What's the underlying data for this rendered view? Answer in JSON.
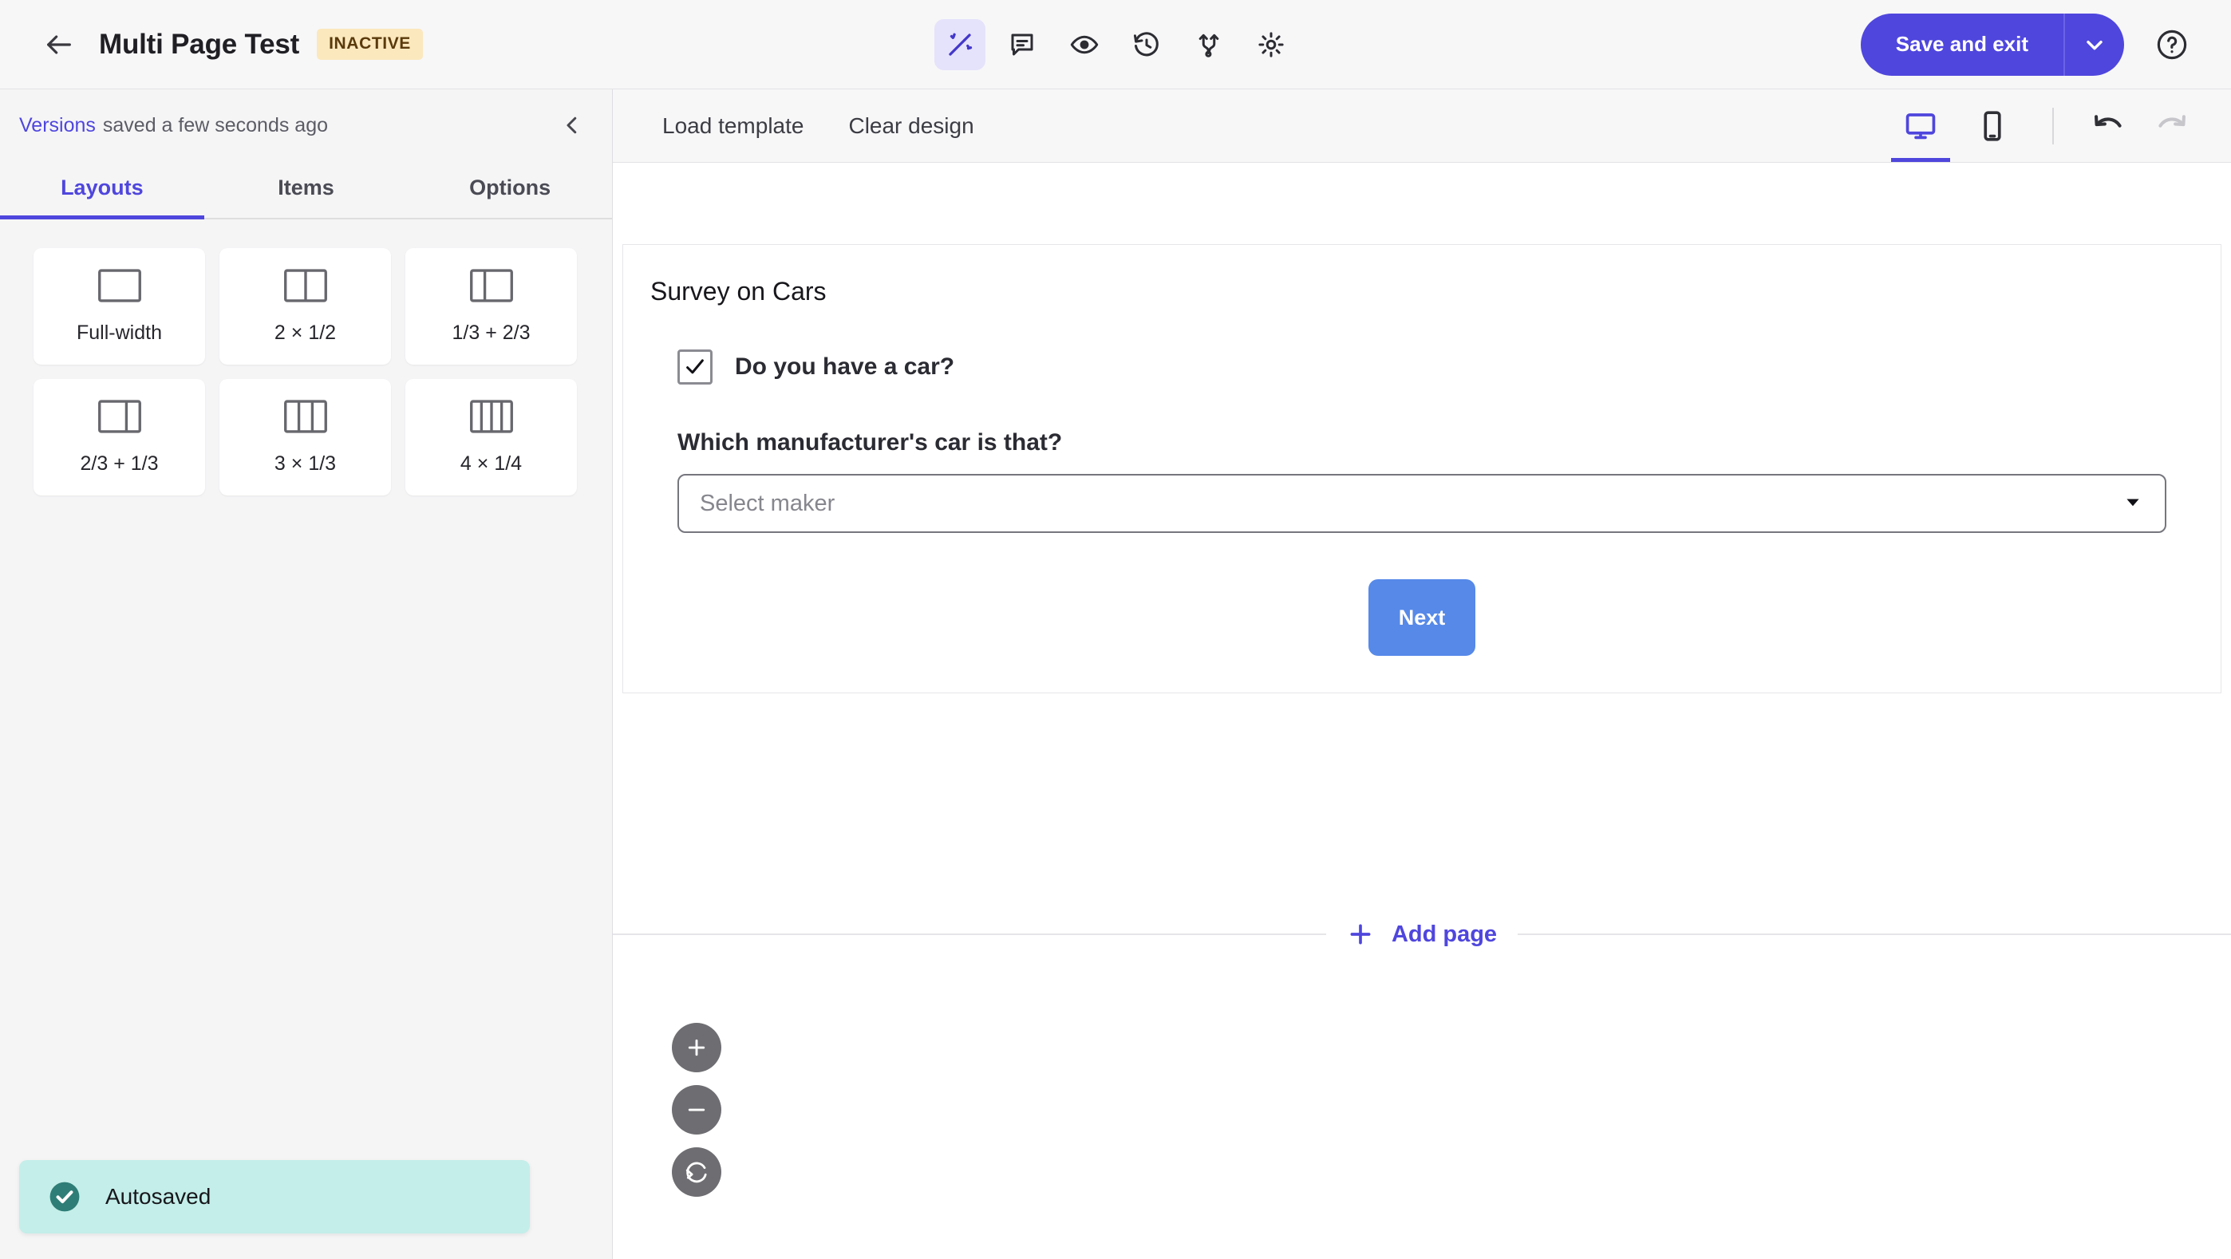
{
  "topbar": {
    "back_icon": "arrow-left-icon",
    "title": "Multi Page Test",
    "status": "INACTIVE",
    "tools": [
      {
        "name": "design-tool",
        "icon": "magic-wand-icon",
        "active": true
      },
      {
        "name": "comments-tool",
        "icon": "comment-icon",
        "active": false
      },
      {
        "name": "preview-tool",
        "icon": "eye-icon",
        "active": false
      },
      {
        "name": "history-tool",
        "icon": "history-icon",
        "active": false
      },
      {
        "name": "logic-tool",
        "icon": "branch-icon",
        "active": false
      },
      {
        "name": "settings-tool",
        "icon": "gear-icon",
        "active": false
      }
    ],
    "save_label": "Save and exit",
    "save_caret_icon": "chevron-down-icon",
    "help_icon": "question-circle-icon"
  },
  "sidebar": {
    "versions_link": "Versions",
    "versions_status": "saved a few seconds ago",
    "collapse_icon": "chevron-left-icon",
    "tabs": [
      {
        "label": "Layouts",
        "active": true
      },
      {
        "label": "Items",
        "active": false
      },
      {
        "label": "Options",
        "active": false
      }
    ],
    "layouts": [
      {
        "label": "Full-width",
        "icon": "layout-full-icon",
        "cols": [
          1
        ]
      },
      {
        "label": "2 × 1/2",
        "icon": "layout-two-half-icon",
        "cols": [
          1,
          1
        ]
      },
      {
        "label": "1/3 + 2/3",
        "icon": "layout-third-twothird-icon",
        "cols": [
          1,
          2
        ]
      },
      {
        "label": "2/3 + 1/3",
        "icon": "layout-twothird-third-icon",
        "cols": [
          2,
          1
        ]
      },
      {
        "label": "3 × 1/3",
        "icon": "layout-three-third-icon",
        "cols": [
          1,
          1,
          1
        ]
      },
      {
        "label": "4 × 1/4",
        "icon": "layout-four-quarter-icon",
        "cols": [
          1,
          1,
          1,
          1
        ]
      }
    ],
    "toast": {
      "icon": "check-circle-icon",
      "text": "Autosaved"
    }
  },
  "canvas": {
    "load_template_label": "Load template",
    "clear_design_label": "Clear design",
    "devices": [
      {
        "name": "desktop",
        "icon": "monitor-icon",
        "active": true
      },
      {
        "name": "mobile",
        "icon": "phone-icon",
        "active": false
      }
    ],
    "undo": {
      "icon": "undo-icon",
      "enabled": true
    },
    "redo": {
      "icon": "redo-icon",
      "enabled": false
    },
    "page": {
      "heading": "Survey on Cars",
      "checkbox_question": "Do you have a car?",
      "checkbox_checked": true,
      "select_question": "Which manufacturer's car is that?",
      "select_placeholder": "Select maker",
      "select_value": "",
      "select_caret_icon": "caret-down-icon",
      "next_label": "Next"
    },
    "add_page": {
      "label": "Add page",
      "icon": "plus-icon"
    },
    "zoom_controls": [
      {
        "name": "zoom-in",
        "icon": "plus-icon"
      },
      {
        "name": "zoom-out",
        "icon": "minus-icon"
      },
      {
        "name": "zoom-reset",
        "icon": "reset-icon"
      }
    ]
  },
  "colors": {
    "accent": "#4f46dd",
    "badge_bg": "#fbe8bd",
    "badge_text": "#5a3a0c",
    "next_button": "#5689e8",
    "toast_bg": "#c4eee9",
    "toast_icon": "#2f7d77",
    "sidebar_bg": "#f5f5f6",
    "topbar_bg": "#f7f7f8"
  }
}
